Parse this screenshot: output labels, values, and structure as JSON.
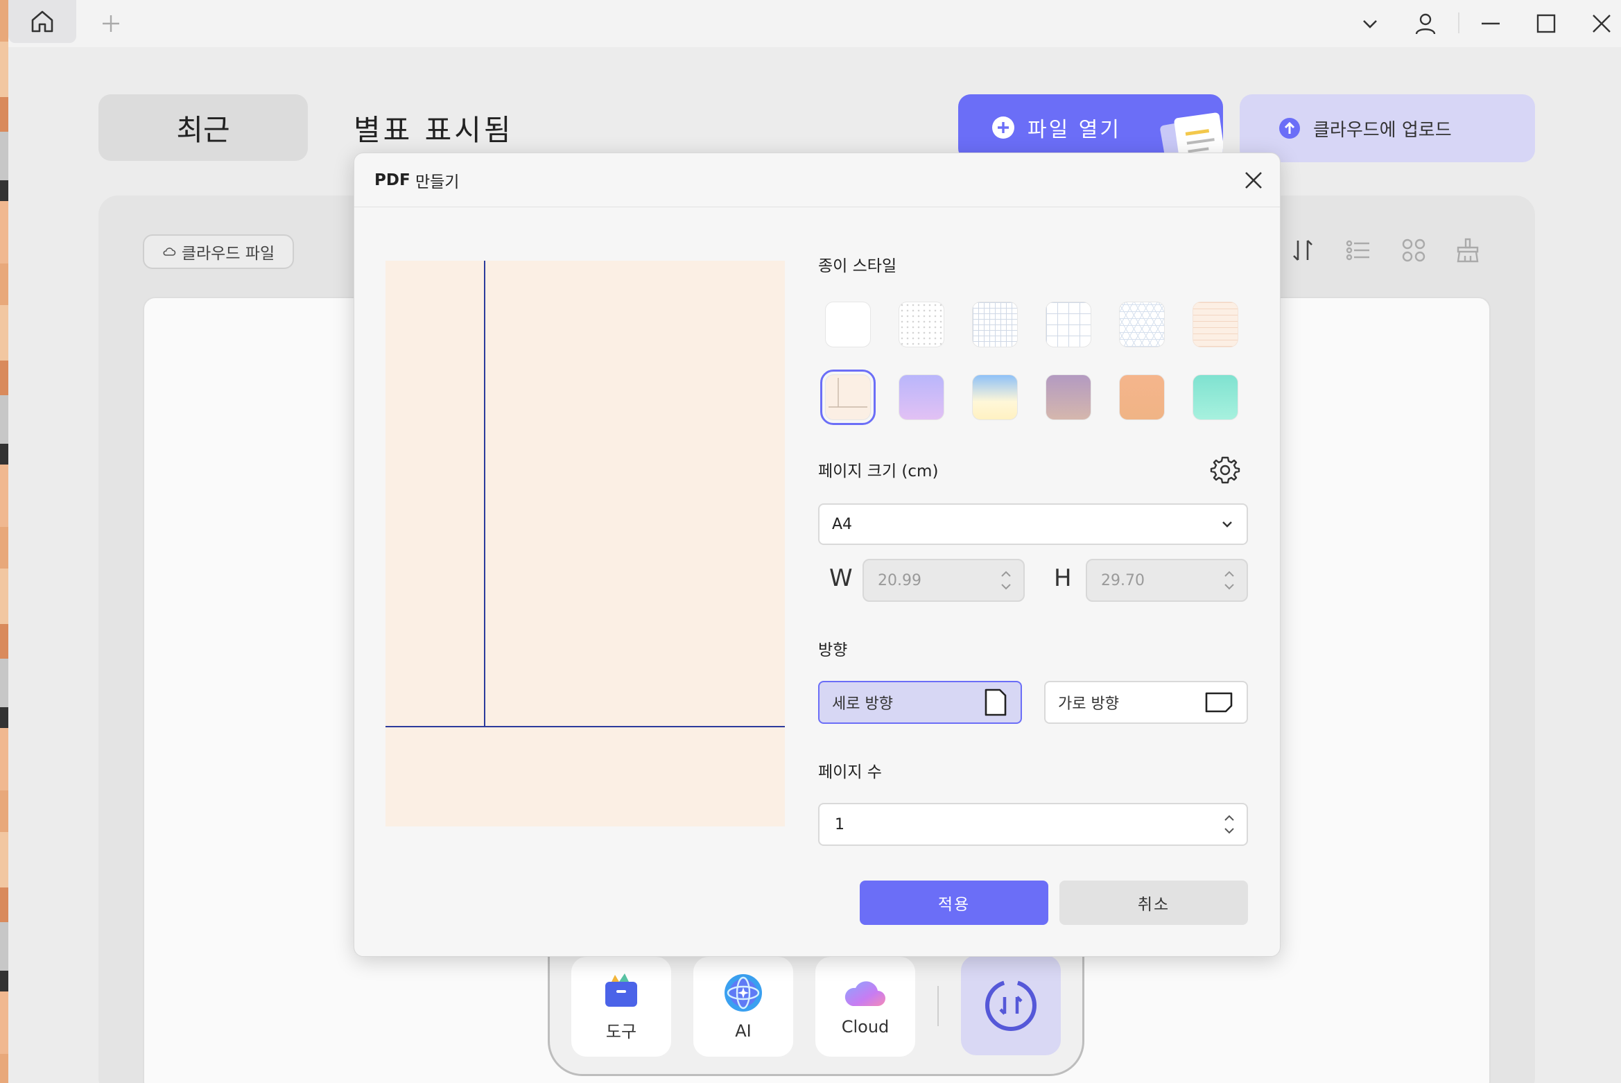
{
  "titlebar": {
    "home_icon": "home-icon",
    "new_tab_icon": "plus-icon"
  },
  "nav": {
    "recent_label": "최근",
    "starred_label": "별표 표시됨",
    "open_file_label": "파일 열기",
    "upload_label": "클라우드에 업로드",
    "cloud_files_label": "클라우드 파일"
  },
  "dock": {
    "tools_label": "도구",
    "ai_label": "AI",
    "cloud_label": "Cloud"
  },
  "dialog": {
    "title_bold": "PDF",
    "title_rest": " 만들기",
    "paper_style_label": "종이 스타일",
    "paper_styles": [
      "blank",
      "dotted",
      "grid-small",
      "grid-large",
      "isometric",
      "lined-peach",
      "cornell-peach",
      "gradient-lavender",
      "gradient-sky",
      "gradient-mauve",
      "gradient-orange",
      "gradient-mint"
    ],
    "selected_paper_style": "cornell-peach",
    "page_size_label": "페이지 크기 (cm)",
    "page_size_value": "A4",
    "width_letter": "W",
    "width_value": "20.99",
    "height_letter": "H",
    "height_value": "29.70",
    "orientation_label": "방향",
    "portrait_label": "세로 방향",
    "landscape_label": "가로 방향",
    "selected_orientation": "portrait",
    "page_count_label": "페이지 수",
    "page_count_value": "1",
    "apply_label": "적용",
    "cancel_label": "취소"
  },
  "colors": {
    "accent": "#6b6ef7",
    "accent_light": "#d7d7f4",
    "preview_paper": "#fbefe4",
    "preview_line": "#2b3a9c"
  }
}
